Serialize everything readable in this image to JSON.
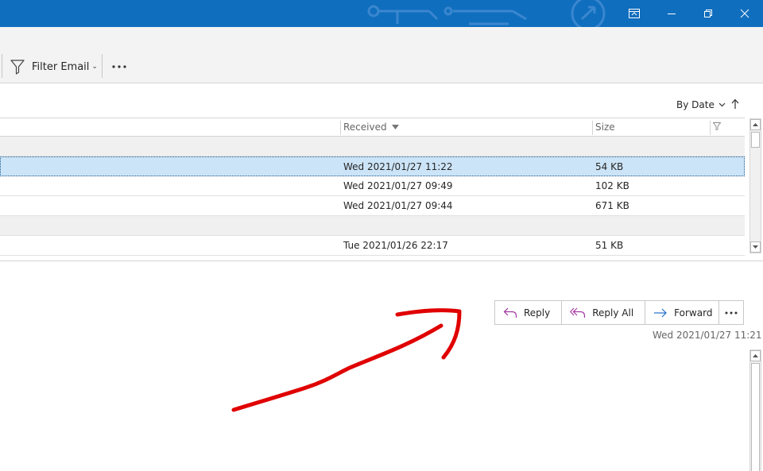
{
  "ribbon": {
    "filter_email_label": "Filter Email"
  },
  "sortbar": {
    "sort_by_label": "By Date"
  },
  "list": {
    "columns": {
      "received": "Received",
      "size": "Size"
    },
    "rows": [
      {
        "received": "Wed 2021/01/27 11:22",
        "size": "54 KB",
        "selected": true
      },
      {
        "received": "Wed 2021/01/27 09:49",
        "size": "102 KB",
        "selected": false
      },
      {
        "received": "Wed 2021/01/27 09:44",
        "size": "671 KB",
        "selected": false
      },
      {
        "received": "Tue 2021/01/26 22:17",
        "size": "51 KB",
        "selected": false
      }
    ]
  },
  "reading_pane": {
    "reply_label": "Reply",
    "reply_all_label": "Reply All",
    "forward_label": "Forward",
    "message_date": "Wed 2021/01/27 11:21"
  },
  "colors": {
    "titlebar": "#106ebe",
    "selection": "#cce4f7",
    "reply_icon": "#a43aa3",
    "forward_icon": "#1e6fc9",
    "annotation": "#e00000"
  },
  "icons": {
    "titlebar": [
      "ribbon-display-icon",
      "minimize-icon",
      "restore-icon",
      "close-icon"
    ],
    "ribbon": [
      "filter-icon",
      "more-icon",
      "chevron-down-icon"
    ],
    "actions": [
      "reply-icon",
      "reply-all-icon",
      "forward-icon",
      "more-icon"
    ]
  }
}
